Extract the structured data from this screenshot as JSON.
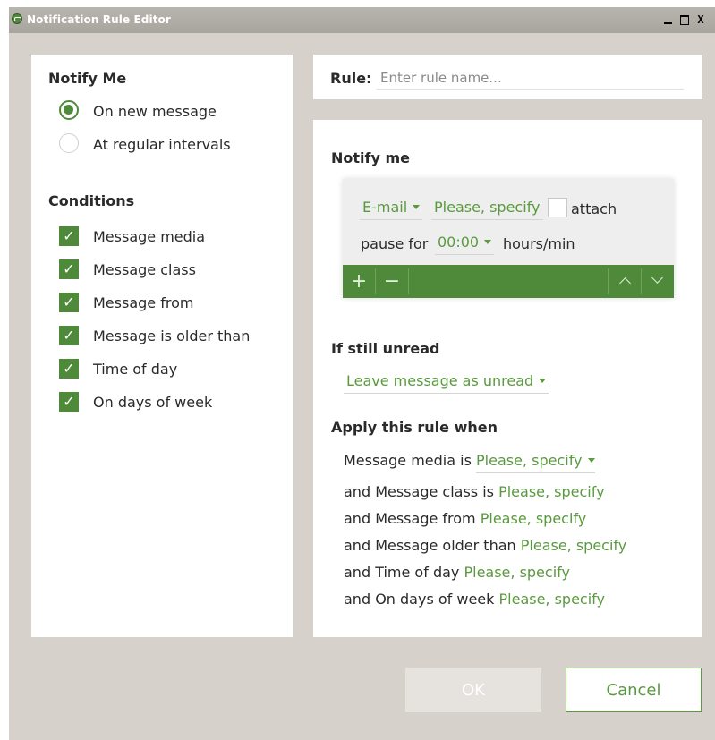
{
  "window": {
    "title": "Notification Rule Editor",
    "controls": {
      "minimize": "_",
      "maximize": "□",
      "close": "X"
    }
  },
  "left": {
    "notify_heading": "Notify Me",
    "notify_options": [
      {
        "label": "On new message",
        "selected": true
      },
      {
        "label": "At regular intervals",
        "selected": false
      }
    ],
    "conditions_heading": "Conditions",
    "conditions": [
      {
        "label": "Message media",
        "checked": true
      },
      {
        "label": "Message class",
        "checked": true
      },
      {
        "label": "Message from",
        "checked": true
      },
      {
        "label": "Message is older than",
        "checked": true
      },
      {
        "label": "Time of day",
        "checked": true
      },
      {
        "label": "On days of week",
        "checked": true
      }
    ]
  },
  "rule": {
    "label": "Rule:",
    "placeholder": "Enter rule name...",
    "value": ""
  },
  "main": {
    "notify_heading": "Notify me",
    "action": {
      "method": "E-mail",
      "target": "Please, specify",
      "attach_label": "attach",
      "attach_checked": false,
      "pause_label": "pause for",
      "pause_value": "00:00",
      "pause_unit": "hours/min",
      "add_symbol": "+",
      "remove_symbol": "−"
    },
    "unread_heading": "If still unread",
    "unread_action": "Leave message as unread",
    "apply_heading": "Apply this rule when",
    "conditions": [
      {
        "prefix": "Message media is",
        "value": "Please, specify",
        "dropdown": true
      },
      {
        "prefix": "and Message class is",
        "value": "Please, specify",
        "dropdown": false
      },
      {
        "prefix": "and Message from",
        "value": "Please, specify",
        "dropdown": false
      },
      {
        "prefix": "and Message older than",
        "value": "Please, specify",
        "dropdown": false
      },
      {
        "prefix": "and Time of day",
        "value": "Please, specify",
        "dropdown": false
      },
      {
        "prefix": "and On days of week",
        "value": "Please, specify",
        "dropdown": false
      }
    ]
  },
  "buttons": {
    "ok": "OK",
    "cancel": "Cancel"
  },
  "colors": {
    "accent": "#4e8a3a",
    "link": "#5a9a3e",
    "background": "#d6d2cb",
    "titlebar": "#aeaaa4"
  }
}
